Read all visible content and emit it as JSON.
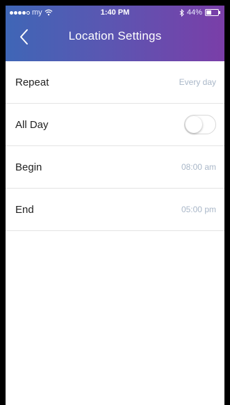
{
  "status_bar": {
    "carrier": "my",
    "time": "1:40 PM",
    "battery_text": "44%",
    "battery_level": 0.44
  },
  "nav": {
    "back_icon": "chevron-left-icon",
    "title": "Location Settings"
  },
  "settings": {
    "repeat": {
      "label": "Repeat",
      "value": "Every day"
    },
    "all_day": {
      "label": "All Day",
      "enabled": false
    },
    "begin": {
      "label": "Begin",
      "value": "08:00 am"
    },
    "end": {
      "label": "End",
      "value": "05:00 pm"
    }
  },
  "colors": {
    "header_gradient_start": "#3f66b6",
    "header_gradient_end": "#7a3ea8",
    "value_text": "#a9b7c8"
  }
}
